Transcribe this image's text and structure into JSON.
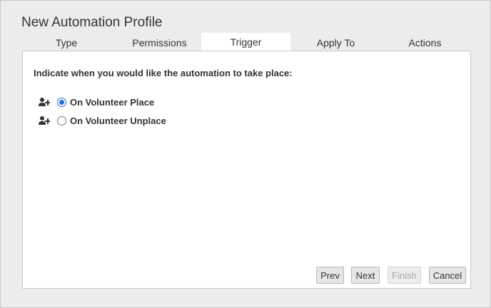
{
  "dialog": {
    "title": "New Automation Profile"
  },
  "tabs": [
    {
      "label": "Type",
      "active": false
    },
    {
      "label": "Permissions",
      "active": false
    },
    {
      "label": "Trigger",
      "active": true
    },
    {
      "label": "Apply To",
      "active": false
    },
    {
      "label": "Actions",
      "active": false
    }
  ],
  "trigger": {
    "prompt": "Indicate when you would like the automation to take place:",
    "options": [
      {
        "label": "On Volunteer Place",
        "checked": true,
        "icon": "person-add-icon"
      },
      {
        "label": "On Volunteer Unplace",
        "checked": false,
        "icon": "person-add-icon"
      }
    ]
  },
  "buttons": {
    "prev": "Prev",
    "next": "Next",
    "finish": "Finish",
    "finish_disabled": true,
    "cancel": "Cancel"
  },
  "colors": {
    "active_tab_underline": "#c9a24a",
    "radio_selected": "#1f6fd0",
    "background": "#ececec"
  }
}
